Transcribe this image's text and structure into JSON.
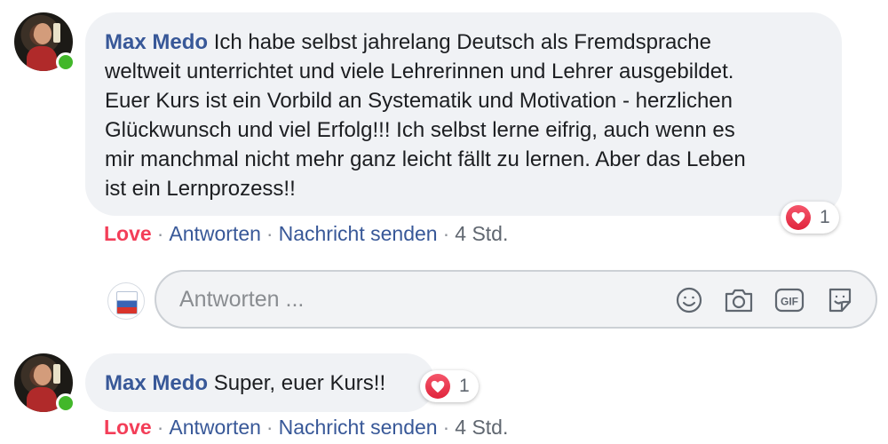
{
  "comments": [
    {
      "author": "Max Medo",
      "text_lines": [
        "Ich habe selbst jahrelang Deutsch als Fremdsprache",
        "weltweit unterrichtet und viele Lehrerinnen und Lehrer ausgebildet.",
        "Euer Kurs ist ein Vorbild an Systematik und Motivation - herzlichen",
        "Glückwunsch und viel Erfolg!!! Ich selbst lerne eifrig, auch wenn es",
        "mir manchmal nicht mehr ganz leicht fällt zu lernen. Aber das Leben",
        "ist ein Lernprozess!!"
      ],
      "reaction_count": "1",
      "actions": {
        "love": "Love",
        "reply": "Antworten",
        "message": "Nachricht senden",
        "separator": "·",
        "time": "4 Std."
      }
    },
    {
      "author": "Max Medo",
      "text": "Super, euer Kurs!!",
      "reaction_count": "1",
      "actions": {
        "love": "Love",
        "reply": "Antworten",
        "message": "Nachricht senden",
        "separator": "·",
        "time": "4 Std."
      }
    }
  ],
  "reply_box": {
    "placeholder": "Antworten ...",
    "tools": [
      "emoji-icon",
      "camera-icon",
      "gif-icon",
      "sticker-icon"
    ]
  },
  "colors": {
    "author": "#385898",
    "love": "#f33e58",
    "bubble": "#f0f2f5",
    "online": "#42b72a"
  }
}
